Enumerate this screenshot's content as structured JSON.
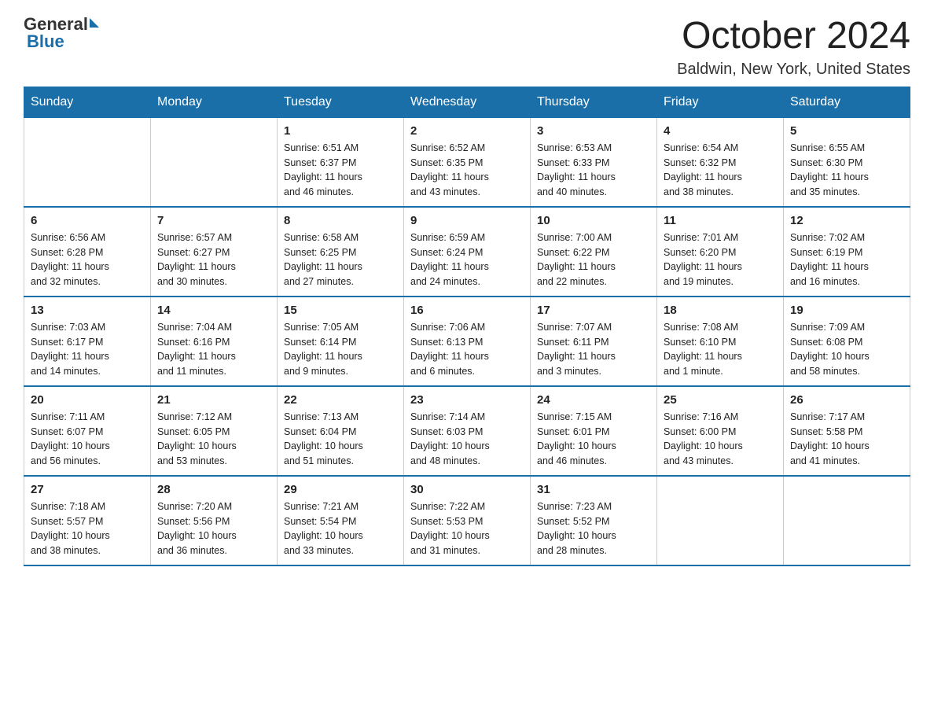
{
  "header": {
    "logo_general": "General",
    "logo_blue": "Blue",
    "month_year": "October 2024",
    "location": "Baldwin, New York, United States"
  },
  "weekdays": [
    "Sunday",
    "Monday",
    "Tuesday",
    "Wednesday",
    "Thursday",
    "Friday",
    "Saturday"
  ],
  "weeks": [
    [
      {
        "day": "",
        "info": ""
      },
      {
        "day": "",
        "info": ""
      },
      {
        "day": "1",
        "info": "Sunrise: 6:51 AM\nSunset: 6:37 PM\nDaylight: 11 hours\nand 46 minutes."
      },
      {
        "day": "2",
        "info": "Sunrise: 6:52 AM\nSunset: 6:35 PM\nDaylight: 11 hours\nand 43 minutes."
      },
      {
        "day": "3",
        "info": "Sunrise: 6:53 AM\nSunset: 6:33 PM\nDaylight: 11 hours\nand 40 minutes."
      },
      {
        "day": "4",
        "info": "Sunrise: 6:54 AM\nSunset: 6:32 PM\nDaylight: 11 hours\nand 38 minutes."
      },
      {
        "day": "5",
        "info": "Sunrise: 6:55 AM\nSunset: 6:30 PM\nDaylight: 11 hours\nand 35 minutes."
      }
    ],
    [
      {
        "day": "6",
        "info": "Sunrise: 6:56 AM\nSunset: 6:28 PM\nDaylight: 11 hours\nand 32 minutes."
      },
      {
        "day": "7",
        "info": "Sunrise: 6:57 AM\nSunset: 6:27 PM\nDaylight: 11 hours\nand 30 minutes."
      },
      {
        "day": "8",
        "info": "Sunrise: 6:58 AM\nSunset: 6:25 PM\nDaylight: 11 hours\nand 27 minutes."
      },
      {
        "day": "9",
        "info": "Sunrise: 6:59 AM\nSunset: 6:24 PM\nDaylight: 11 hours\nand 24 minutes."
      },
      {
        "day": "10",
        "info": "Sunrise: 7:00 AM\nSunset: 6:22 PM\nDaylight: 11 hours\nand 22 minutes."
      },
      {
        "day": "11",
        "info": "Sunrise: 7:01 AM\nSunset: 6:20 PM\nDaylight: 11 hours\nand 19 minutes."
      },
      {
        "day": "12",
        "info": "Sunrise: 7:02 AM\nSunset: 6:19 PM\nDaylight: 11 hours\nand 16 minutes."
      }
    ],
    [
      {
        "day": "13",
        "info": "Sunrise: 7:03 AM\nSunset: 6:17 PM\nDaylight: 11 hours\nand 14 minutes."
      },
      {
        "day": "14",
        "info": "Sunrise: 7:04 AM\nSunset: 6:16 PM\nDaylight: 11 hours\nand 11 minutes."
      },
      {
        "day": "15",
        "info": "Sunrise: 7:05 AM\nSunset: 6:14 PM\nDaylight: 11 hours\nand 9 minutes."
      },
      {
        "day": "16",
        "info": "Sunrise: 7:06 AM\nSunset: 6:13 PM\nDaylight: 11 hours\nand 6 minutes."
      },
      {
        "day": "17",
        "info": "Sunrise: 7:07 AM\nSunset: 6:11 PM\nDaylight: 11 hours\nand 3 minutes."
      },
      {
        "day": "18",
        "info": "Sunrise: 7:08 AM\nSunset: 6:10 PM\nDaylight: 11 hours\nand 1 minute."
      },
      {
        "day": "19",
        "info": "Sunrise: 7:09 AM\nSunset: 6:08 PM\nDaylight: 10 hours\nand 58 minutes."
      }
    ],
    [
      {
        "day": "20",
        "info": "Sunrise: 7:11 AM\nSunset: 6:07 PM\nDaylight: 10 hours\nand 56 minutes."
      },
      {
        "day": "21",
        "info": "Sunrise: 7:12 AM\nSunset: 6:05 PM\nDaylight: 10 hours\nand 53 minutes."
      },
      {
        "day": "22",
        "info": "Sunrise: 7:13 AM\nSunset: 6:04 PM\nDaylight: 10 hours\nand 51 minutes."
      },
      {
        "day": "23",
        "info": "Sunrise: 7:14 AM\nSunset: 6:03 PM\nDaylight: 10 hours\nand 48 minutes."
      },
      {
        "day": "24",
        "info": "Sunrise: 7:15 AM\nSunset: 6:01 PM\nDaylight: 10 hours\nand 46 minutes."
      },
      {
        "day": "25",
        "info": "Sunrise: 7:16 AM\nSunset: 6:00 PM\nDaylight: 10 hours\nand 43 minutes."
      },
      {
        "day": "26",
        "info": "Sunrise: 7:17 AM\nSunset: 5:58 PM\nDaylight: 10 hours\nand 41 minutes."
      }
    ],
    [
      {
        "day": "27",
        "info": "Sunrise: 7:18 AM\nSunset: 5:57 PM\nDaylight: 10 hours\nand 38 minutes."
      },
      {
        "day": "28",
        "info": "Sunrise: 7:20 AM\nSunset: 5:56 PM\nDaylight: 10 hours\nand 36 minutes."
      },
      {
        "day": "29",
        "info": "Sunrise: 7:21 AM\nSunset: 5:54 PM\nDaylight: 10 hours\nand 33 minutes."
      },
      {
        "day": "30",
        "info": "Sunrise: 7:22 AM\nSunset: 5:53 PM\nDaylight: 10 hours\nand 31 minutes."
      },
      {
        "day": "31",
        "info": "Sunrise: 7:23 AM\nSunset: 5:52 PM\nDaylight: 10 hours\nand 28 minutes."
      },
      {
        "day": "",
        "info": ""
      },
      {
        "day": "",
        "info": ""
      }
    ]
  ]
}
